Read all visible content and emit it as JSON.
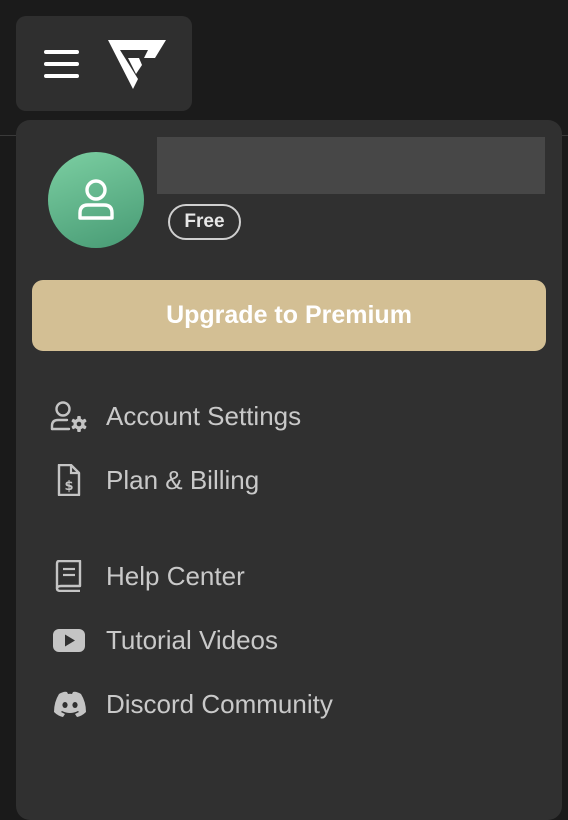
{
  "header": {
    "menu_icon": "hamburger-menu-icon",
    "logo_icon": "brand-logo-icon"
  },
  "profile": {
    "avatar_icon": "user-icon",
    "username": "",
    "plan_badge": "Free"
  },
  "upgrade_button": {
    "label": "Upgrade to Premium",
    "color": "#d3bf94"
  },
  "menu": {
    "account_settings": {
      "label": "Account Settings",
      "icon": "user-gear-icon"
    },
    "plan_billing": {
      "label": "Plan & Billing",
      "icon": "invoice-dollar-icon"
    },
    "help_center": {
      "label": "Help Center",
      "icon": "book-icon"
    },
    "tutorial_videos": {
      "label": "Tutorial Videos",
      "icon": "youtube-icon"
    },
    "discord_community": {
      "label": "Discord Community",
      "icon": "discord-icon"
    }
  },
  "colors": {
    "background": "#1a1a1a",
    "panel": "#303030",
    "accent": "#d3bf94",
    "avatar": "#5fb88a"
  }
}
